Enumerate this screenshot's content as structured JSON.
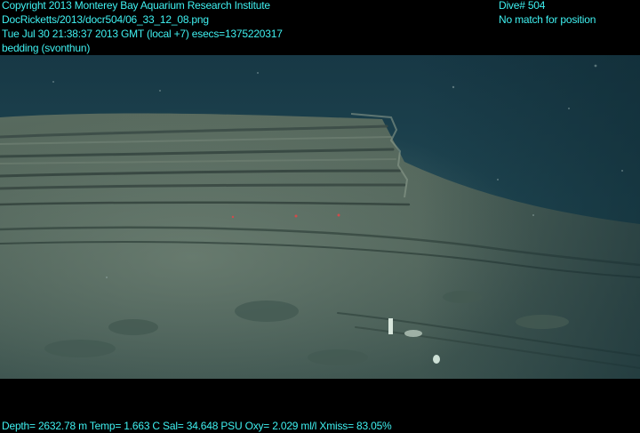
{
  "overlay": {
    "copyright": "Copyright 2013 Monterey Bay Aquarium Research Institute",
    "filepath": "DocRicketts/2013/docr504/06_33_12_08.png",
    "timestamp": "Tue Jul 30 21:38:37 2013 GMT (local +7)  esecs=1375220317",
    "annotation": "bedding (svonthun)",
    "dive": "Dive# 504",
    "position": "No match for position",
    "telemetry": "Depth= 2632.78 m  Temp= 1.663 C  Sal= 34.648 PSU  Oxy= 2.029 ml/l  Xmiss= 83.05%"
  },
  "colors": {
    "overlay_text": "#3ff0f0",
    "frame": "#000000",
    "water": "#1b3d4a",
    "sediment": "#5a6c5e"
  }
}
